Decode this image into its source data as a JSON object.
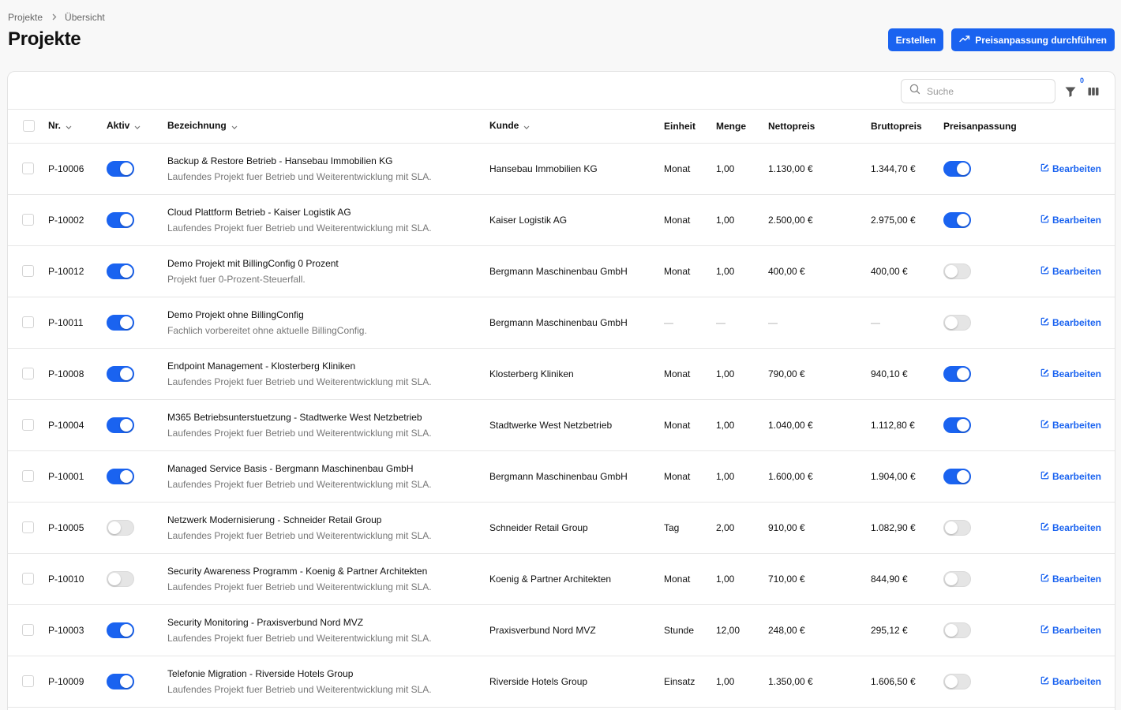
{
  "breadcrumb": {
    "root": "Projekte",
    "current": "Übersicht"
  },
  "page": {
    "title": "Projekte"
  },
  "actions": {
    "create_label": "Erstellen",
    "price_adjust_label": "Preisanpassung durchführen"
  },
  "toolbar": {
    "search_placeholder": "Suche",
    "filter_count": "0"
  },
  "columns": {
    "nr": "Nr.",
    "aktiv": "Aktiv",
    "bezeichnung": "Bezeichnung",
    "kunde": "Kunde",
    "einheit": "Einheit",
    "menge": "Menge",
    "nettopreis": "Nettopreis",
    "bruttopreis": "Bruttopreis",
    "preisanpassung": "Preisanpassung"
  },
  "edit_label": "Bearbeiten",
  "colors": {
    "accent": "#1a63f0"
  },
  "rows": [
    {
      "nr": "P-10006",
      "aktiv": true,
      "title": "Backup & Restore Betrieb - Hansebau Immobilien KG",
      "desc": "Laufendes Projekt fuer Betrieb und Weiterentwicklung mit SLA.",
      "kunde": "Hansebau Immobilien KG",
      "einheit": "Monat",
      "menge": "1,00",
      "netto": "1.130,00 €",
      "brutto": "1.344,70 €",
      "preisanpassung": true
    },
    {
      "nr": "P-10002",
      "aktiv": true,
      "title": "Cloud Plattform Betrieb - Kaiser Logistik AG",
      "desc": "Laufendes Projekt fuer Betrieb und Weiterentwicklung mit SLA.",
      "kunde": "Kaiser Logistik AG",
      "einheit": "Monat",
      "menge": "1,00",
      "netto": "2.500,00 €",
      "brutto": "2.975,00 €",
      "preisanpassung": true
    },
    {
      "nr": "P-10012",
      "aktiv": true,
      "title": "Demo Projekt mit BillingConfig 0 Prozent",
      "desc": "Projekt fuer 0-Prozent-Steuerfall.",
      "kunde": "Bergmann Maschinenbau GmbH",
      "einheit": "Monat",
      "menge": "1,00",
      "netto": "400,00 €",
      "brutto": "400,00 €",
      "preisanpassung": false
    },
    {
      "nr": "P-10011",
      "aktiv": true,
      "title": "Demo Projekt ohne BillingConfig",
      "desc": "Fachlich vorbereitet ohne aktuelle BillingConfig.",
      "kunde": "Bergmann Maschinenbau GmbH",
      "einheit": "—",
      "menge": "—",
      "netto": "—",
      "brutto": "—",
      "preisanpassung": false
    },
    {
      "nr": "P-10008",
      "aktiv": true,
      "title": "Endpoint Management - Klosterberg Kliniken",
      "desc": "Laufendes Projekt fuer Betrieb und Weiterentwicklung mit SLA.",
      "kunde": "Klosterberg Kliniken",
      "einheit": "Monat",
      "menge": "1,00",
      "netto": "790,00 €",
      "brutto": "940,10 €",
      "preisanpassung": true
    },
    {
      "nr": "P-10004",
      "aktiv": true,
      "title": "M365 Betriebsunterstuetzung - Stadtwerke West Netzbetrieb",
      "desc": "Laufendes Projekt fuer Betrieb und Weiterentwicklung mit SLA.",
      "kunde": "Stadtwerke West Netzbetrieb",
      "einheit": "Monat",
      "menge": "1,00",
      "netto": "1.040,00 €",
      "brutto": "1.112,80 €",
      "preisanpassung": true
    },
    {
      "nr": "P-10001",
      "aktiv": true,
      "title": "Managed Service Basis - Bergmann Maschinenbau GmbH",
      "desc": "Laufendes Projekt fuer Betrieb und Weiterentwicklung mit SLA.",
      "kunde": "Bergmann Maschinenbau GmbH",
      "einheit": "Monat",
      "menge": "1,00",
      "netto": "1.600,00 €",
      "brutto": "1.904,00 €",
      "preisanpassung": true
    },
    {
      "nr": "P-10005",
      "aktiv": false,
      "title": "Netzwerk Modernisierung - Schneider Retail Group",
      "desc": "Laufendes Projekt fuer Betrieb und Weiterentwicklung mit SLA.",
      "kunde": "Schneider Retail Group",
      "einheit": "Tag",
      "menge": "2,00",
      "netto": "910,00 €",
      "brutto": "1.082,90 €",
      "preisanpassung": false
    },
    {
      "nr": "P-10010",
      "aktiv": false,
      "title": "Security Awareness Programm - Koenig & Partner Architekten",
      "desc": "Laufendes Projekt fuer Betrieb und Weiterentwicklung mit SLA.",
      "kunde": "Koenig & Partner Architekten",
      "einheit": "Monat",
      "menge": "1,00",
      "netto": "710,00 €",
      "brutto": "844,90 €",
      "preisanpassung": false
    },
    {
      "nr": "P-10003",
      "aktiv": true,
      "title": "Security Monitoring - Praxisverbund Nord MVZ",
      "desc": "Laufendes Projekt fuer Betrieb und Weiterentwicklung mit SLA.",
      "kunde": "Praxisverbund Nord MVZ",
      "einheit": "Stunde",
      "menge": "12,00",
      "netto": "248,00 €",
      "brutto": "295,12 €",
      "preisanpassung": false
    },
    {
      "nr": "P-10009",
      "aktiv": true,
      "title": "Telefonie Migration - Riverside Hotels Group",
      "desc": "Laufendes Projekt fuer Betrieb und Weiterentwicklung mit SLA.",
      "kunde": "Riverside Hotels Group",
      "einheit": "Einsatz",
      "menge": "1,00",
      "netto": "1.350,00 €",
      "brutto": "1.606,50 €",
      "preisanpassung": false
    }
  ]
}
